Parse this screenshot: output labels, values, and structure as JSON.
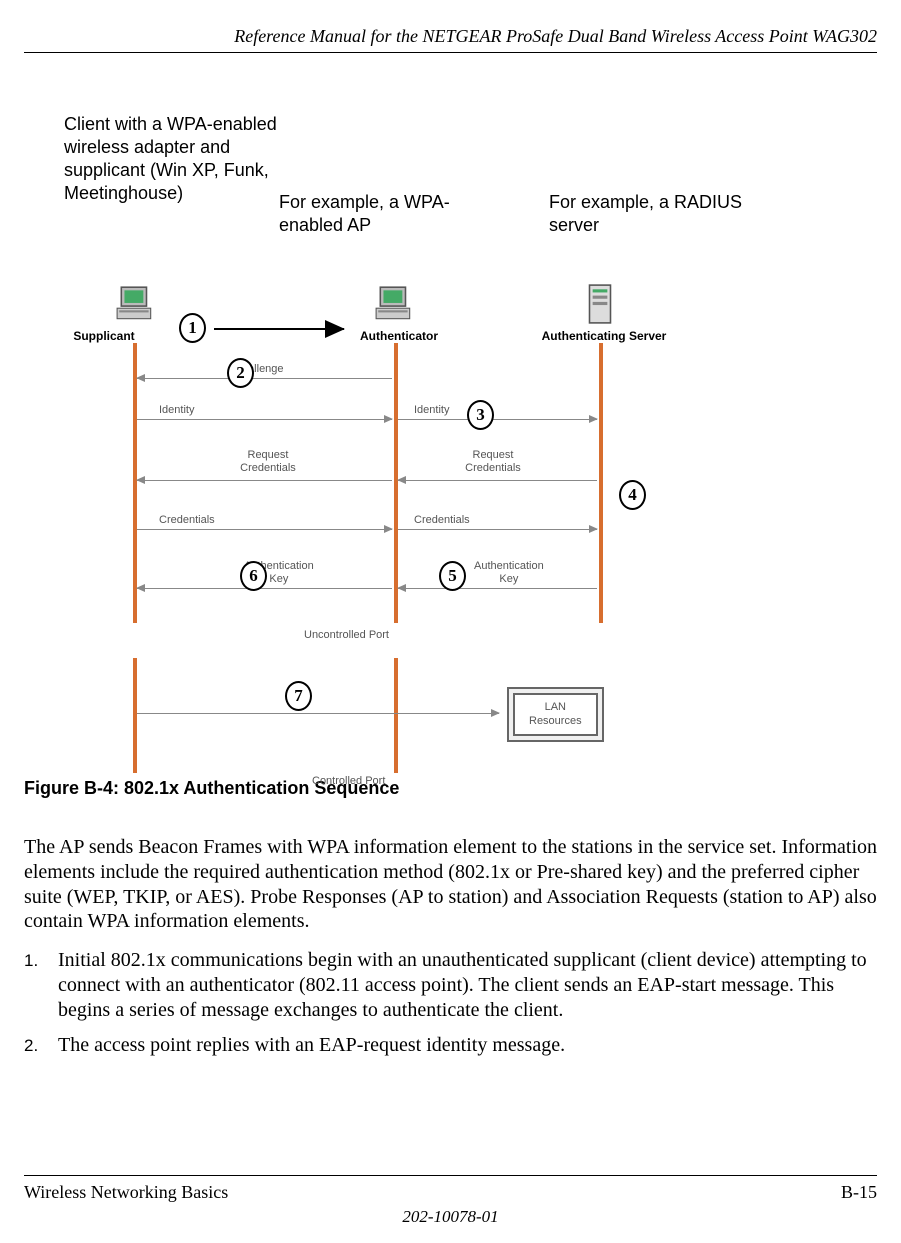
{
  "header": {
    "title": "Reference Manual for the NETGEAR ProSafe Dual Band Wireless Access Point WAG302"
  },
  "figure": {
    "annotations": {
      "supplicant_desc": "Client with a WPA-enabled wireless adapter and supplicant (Win XP, Funk, Meetinghouse)",
      "authenticator_desc": "For example, a WPA-enabled AP",
      "authserver_desc": "For example, a RADIUS server"
    },
    "roles": {
      "supplicant": "Supplicant",
      "authenticator": "Authenticator",
      "authserver": "Authenticating Server"
    },
    "messages": {
      "challenge": "Challenge",
      "identity_left": "Identity",
      "identity_right": "Identity",
      "req_cred_left": "Request\nCredentials",
      "req_cred_right": "Request\nCredentials",
      "credentials_left": "Credentials",
      "credentials_right": "Credentials",
      "authkey_left": "Authentication\nKey",
      "authkey_right": "Authentication\nKey",
      "uncontrolled": "Uncontrolled Port",
      "controlled": "Controlled Port",
      "lan": "LAN\nResources"
    },
    "steps": {
      "n1": "1",
      "n2": "2",
      "n3": "3",
      "n4": "4",
      "n5": "5",
      "n6": "6",
      "n7": "7"
    },
    "caption": "Figure B-4:  802.1x Authentication Sequence"
  },
  "body": {
    "intro": "The AP sends Beacon Frames with WPA information element to the stations in the service set. Information elements include the required authentication method (802.1x or Pre-shared key) and the preferred cipher suite (WEP, TKIP, or AES). Probe Responses (AP to station) and Association Requests (station to AP) also contain WPA information elements.",
    "step1": "Initial 802.1x communications begin with an unauthenticated supplicant (client device) attempting to connect with an authenticator (802.11 access point). The client sends an EAP-start message. This begins a series of message exchanges to authenticate the client.",
    "step2": "The access point replies with an EAP-request identity message."
  },
  "footer": {
    "section": "Wireless Networking Basics",
    "page": "B-15",
    "docnum": "202-10078-01"
  }
}
